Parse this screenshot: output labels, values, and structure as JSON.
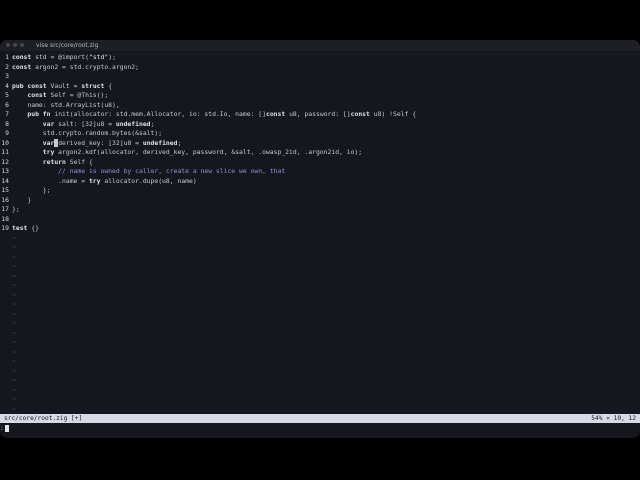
{
  "window": {
    "title": "vise src/core/root.zig"
  },
  "editor": {
    "lines": [
      {
        "num": "1",
        "text": "const std = @import(\"std\");"
      },
      {
        "num": "2",
        "text": "const argon2 = std.crypto.argon2;"
      },
      {
        "num": "3",
        "text": ""
      },
      {
        "num": "4",
        "text": "pub const Vault = struct {"
      },
      {
        "num": "5",
        "text": "    const Self = @This();"
      },
      {
        "num": "6",
        "text": "    name: std.ArrayList(u8),"
      },
      {
        "num": "7",
        "text": "    pub fn init(allocator: std.mem.Allocator, io: std.Io, name: []const u8, password: []const u8) !Self {"
      },
      {
        "num": "8",
        "text": "        var salt: [32]u8 = undefined;"
      },
      {
        "num": "9",
        "text": "        std.crypto.random.bytes(&salt);"
      },
      {
        "num": "10",
        "text": "        var derived_key: [32]u8 = undefined;"
      },
      {
        "num": "11",
        "text": "        try argon2.kdf(allocator, derived_key, password, &salt, .owasp_2id, .argon2id, io);"
      },
      {
        "num": "12",
        "text": "        return Self {"
      },
      {
        "num": "13",
        "text": "            // name is owned by caller, create a new slice we own, that"
      },
      {
        "num": "14",
        "text": "            .name = try allocator.dupe(u8, name)"
      },
      {
        "num": "15",
        "text": "        };"
      },
      {
        "num": "16",
        "text": "    }"
      },
      {
        "num": "17",
        "text": "};"
      },
      {
        "num": "18",
        "text": ""
      },
      {
        "num": "19",
        "text": "test {}"
      }
    ],
    "empty_marker": "~",
    "empty_line_count": 19
  },
  "statusbar": {
    "file": "src/core/root.zig [+]",
    "position": "54% « 10, 12"
  },
  "cmdline": {
    "prompt": ":"
  }
}
